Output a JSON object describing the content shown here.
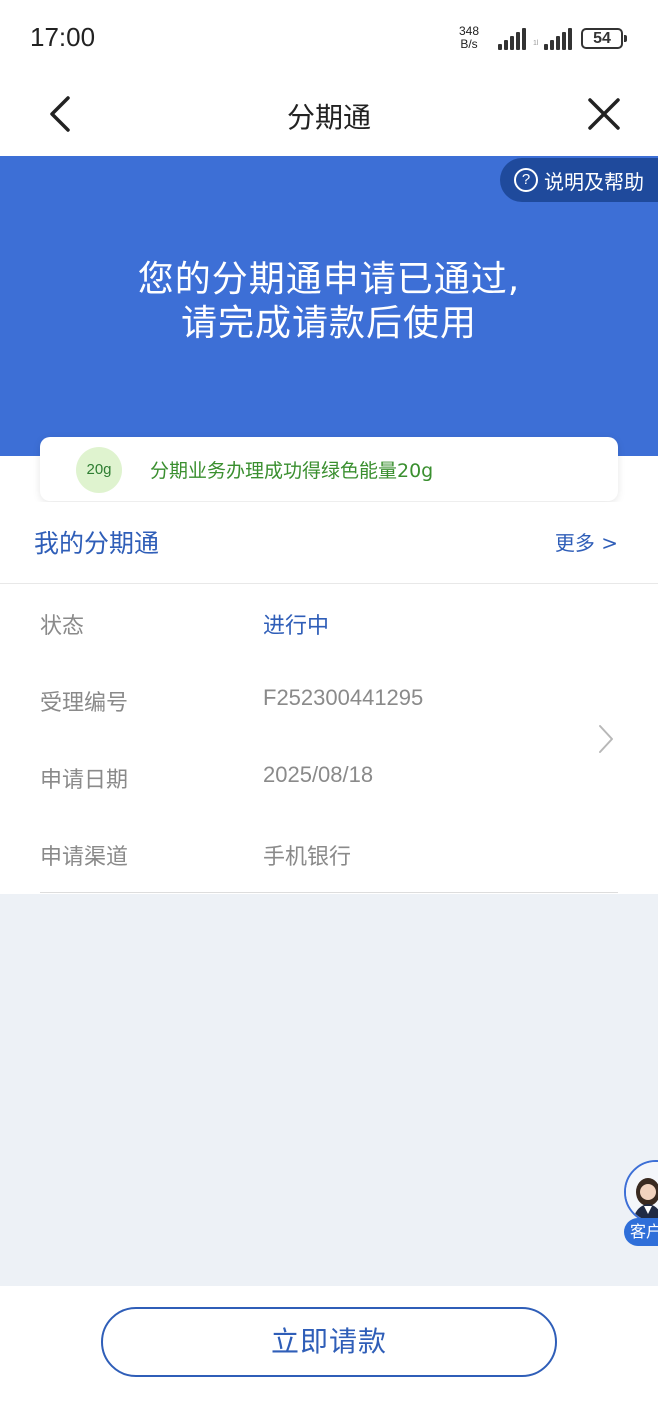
{
  "status_bar": {
    "time": "17:00",
    "net_speed_value": "348",
    "net_speed_unit": "B/s",
    "battery": "54"
  },
  "nav": {
    "title": "分期通"
  },
  "banner": {
    "help_label": "说明及帮助",
    "message_line1": "您的分期通申请已通过,",
    "message_line2": "请完成请款后使用"
  },
  "energy": {
    "badge": "20g",
    "text": "分期业务办理成功得绿色能量20g"
  },
  "section": {
    "title": "我的分期通",
    "more": "更多 >"
  },
  "details": [
    {
      "label": "状态",
      "value": "进行中"
    },
    {
      "label": "受理编号",
      "value": "F252300441295"
    },
    {
      "label": "申请日期",
      "value": "2025/08/18"
    },
    {
      "label": "申请渠道",
      "value": "手机银行"
    }
  ],
  "customer_service": {
    "label": "客户"
  },
  "actions": {
    "request_button": "立即请款"
  },
  "colors": {
    "primary": "#3d6fd6",
    "link_blue": "#2f5eb8",
    "energy_green": "#3a8f2f",
    "page_gray": "#edf1f6"
  }
}
